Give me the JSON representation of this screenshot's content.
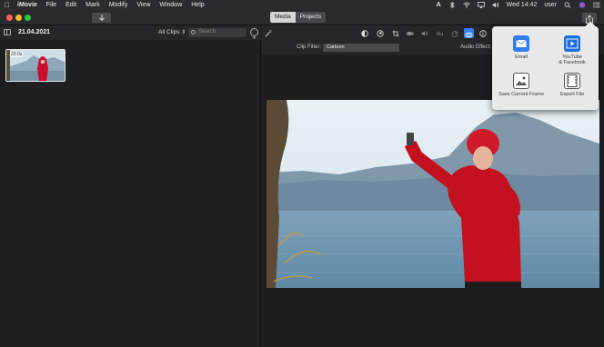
{
  "menubar": {
    "app_name": "iMovie",
    "items": [
      "File",
      "Edit",
      "Mark",
      "Modify",
      "View",
      "Window",
      "Help"
    ],
    "status_text": "A",
    "clock": "Wed 14:42",
    "user": "user"
  },
  "toolbar": {
    "segments": [
      "Media",
      "Projects"
    ],
    "active_segment": "Media"
  },
  "browser": {
    "date": "21.04.2021",
    "filter": "All Clips",
    "search_placeholder": "Search",
    "clip_duration": "20.0s"
  },
  "inspector": {
    "clip_filter_label": "Clip Filter:",
    "clip_filter_value": "Cartoon",
    "audio_effect_label": "Audio Effect:"
  },
  "share_menu": {
    "items": [
      {
        "label": "Email",
        "icon": "email-icon"
      },
      {
        "label": "YouTube\n& Facebook",
        "icon": "youtube-facebook-icon"
      },
      {
        "label": "Save Current Frame",
        "icon": "save-frame-icon"
      },
      {
        "label": "Export File",
        "icon": "export-file-icon"
      }
    ]
  },
  "colors": {
    "accent": "#2f7ef5",
    "window_bg": "#1f1f21",
    "popover_bg": "#e9e9e9"
  }
}
